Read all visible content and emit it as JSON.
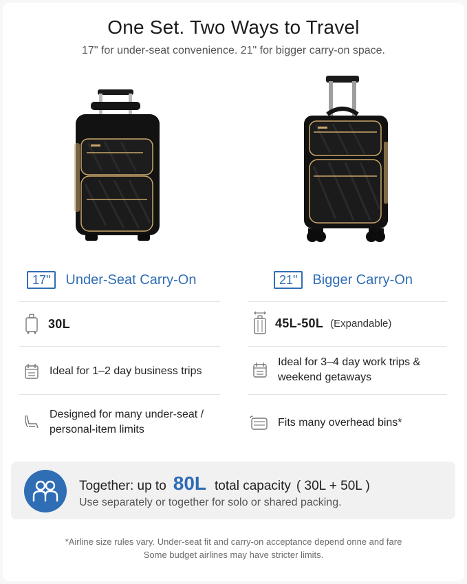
{
  "header": {
    "title": "One Set. Two Ways to Travel",
    "subtitle": "17\" for under-seat convenience. 21\" for bigger carry-on space."
  },
  "left": {
    "badge": "17\"",
    "title": "Under-Seat Carry-On",
    "capacity": "30L",
    "capacity_icon": "suitcase-icon",
    "trips": "Ideal for 1–2 day business trips",
    "trips_icon": "calendar-icon",
    "fit_line1": "Designed for many under-seat /",
    "fit_line2": "personal-item limits",
    "fit_icon": "seat-icon"
  },
  "right": {
    "badge": "21\"",
    "title": "Bigger Carry-On",
    "capacity": "45L-50L",
    "capacity_note": "(Expandable)",
    "capacity_icon": "expandable-suitcase-icon",
    "trips_line1": "Ideal for 3–4 day work trips &",
    "trips_line2": "weekend getaways",
    "trips_icon": "calendar-icon",
    "fit": "Fits many overhead bins*",
    "fit_icon": "overhead-bin-icon"
  },
  "banner": {
    "icon": "two-people-icon",
    "prefix": "Together: up to",
    "amount": "80L",
    "suffix": "total capacity",
    "breakdown": "( 30L + 50L )",
    "note": "Use separately or together for solo or shared packing."
  },
  "footnote": {
    "line1": "*Airline size rules vary. Under-seat fit and carry-on acceptance depend onne and fare",
    "line2": "Some budget airlines may have stricter limits."
  },
  "colors": {
    "accent": "#2f6db5",
    "bag": "#111111",
    "zipper": "#c9a66b"
  }
}
